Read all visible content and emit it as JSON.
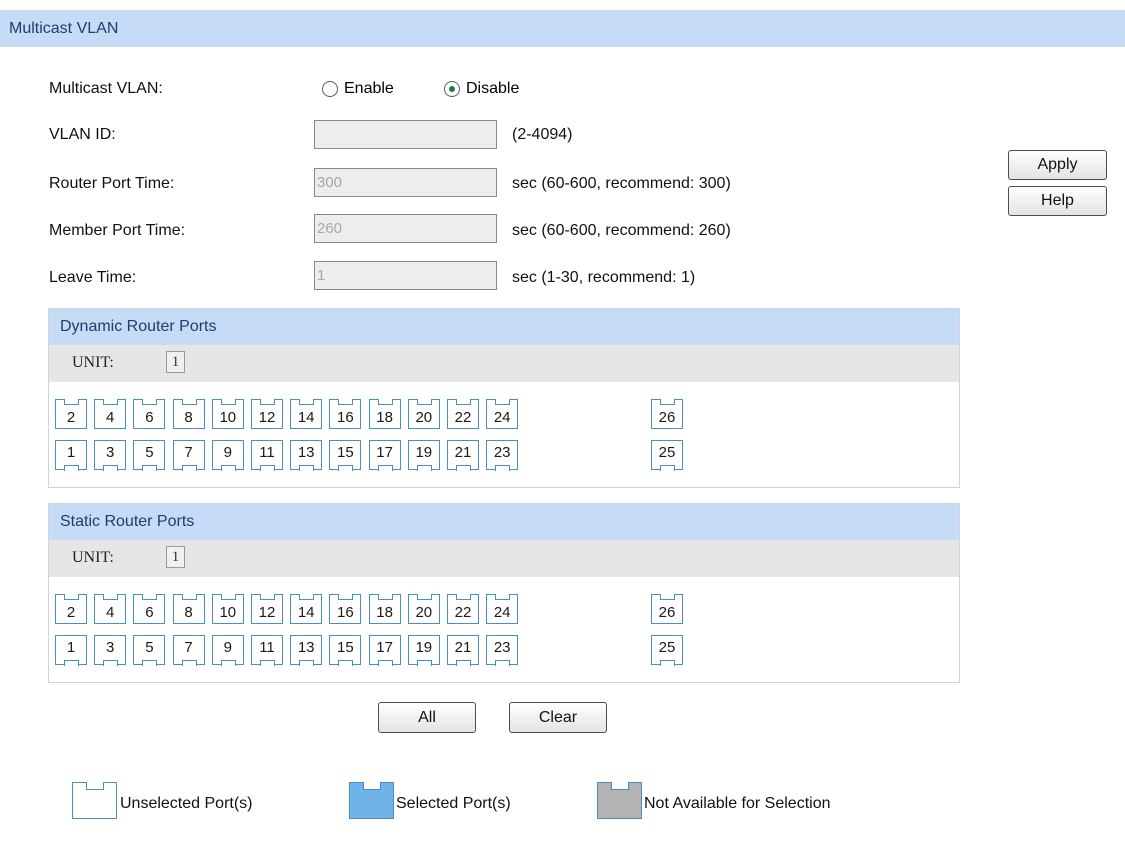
{
  "header": {
    "title": "Multicast VLAN"
  },
  "form": {
    "multicast_vlan": {
      "label": "Multicast VLAN:",
      "enable_label": "Enable",
      "disable_label": "Disable",
      "selected": "Disable"
    },
    "vlan_id": {
      "label": "VLAN ID:",
      "value": "",
      "hint": "(2-4094)"
    },
    "router_port_time": {
      "label": "Router Port Time:",
      "value": "300",
      "hint": "sec (60-600, recommend: 300)"
    },
    "member_port_time": {
      "label": "Member Port Time:",
      "value": "260",
      "hint": "sec (60-600, recommend: 260)"
    },
    "leave_time": {
      "label": "Leave Time:",
      "value": "1",
      "hint": "sec (1-30, recommend: 1)"
    }
  },
  "buttons": {
    "apply": "Apply",
    "help": "Help",
    "all": "All",
    "clear": "Clear"
  },
  "dynamic_panel": {
    "title": "Dynamic Router Ports",
    "unit_label": "UNIT:",
    "unit_value": "1",
    "top_row": [
      "2",
      "4",
      "6",
      "8",
      "10",
      "12",
      "14",
      "16",
      "18",
      "20",
      "22",
      "24"
    ],
    "bottom_row": [
      "1",
      "3",
      "5",
      "7",
      "9",
      "11",
      "13",
      "15",
      "17",
      "19",
      "21",
      "23"
    ],
    "extra_top": "26",
    "extra_bottom": "25"
  },
  "static_panel": {
    "title": "Static Router Ports",
    "unit_label": "UNIT:",
    "unit_value": "1",
    "top_row": [
      "2",
      "4",
      "6",
      "8",
      "10",
      "12",
      "14",
      "16",
      "18",
      "20",
      "22",
      "24"
    ],
    "bottom_row": [
      "1",
      "3",
      "5",
      "7",
      "9",
      "11",
      "13",
      "15",
      "17",
      "19",
      "21",
      "23"
    ],
    "extra_top": "26",
    "extra_bottom": "25"
  },
  "legend": {
    "unselected": "Unselected Port(s)",
    "selected": "Selected Port(s)",
    "unavailable": "Not Available for Selection"
  },
  "colors": {
    "header_bg": "#c5dbf6",
    "port_border": "#4a8ec9",
    "selected_fill": "#6fb3e8",
    "unavailable_fill": "#b3b3b3"
  }
}
